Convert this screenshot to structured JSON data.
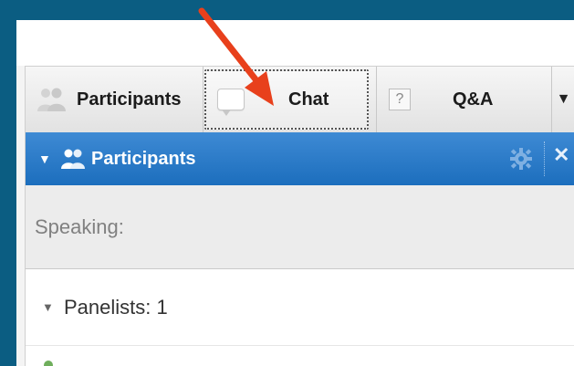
{
  "tabs": [
    {
      "label": "Participants",
      "icon": "people-icon"
    },
    {
      "label": "Chat",
      "icon": "chat-bubble-icon"
    },
    {
      "label": "Q&A",
      "icon": "question-icon",
      "icon_text": "?"
    }
  ],
  "tab_dropdown": "▼",
  "panel": {
    "title": "Participants",
    "collapse_glyph": "▼",
    "close_glyph": "✕"
  },
  "speaking_label": "Speaking:",
  "panelists": {
    "label": "Panelists: 1",
    "caret": "▼"
  },
  "colors": {
    "frame": "#0b5d82",
    "titlebar": "#2a7cc9",
    "annotation_arrow": "#e8401c"
  }
}
